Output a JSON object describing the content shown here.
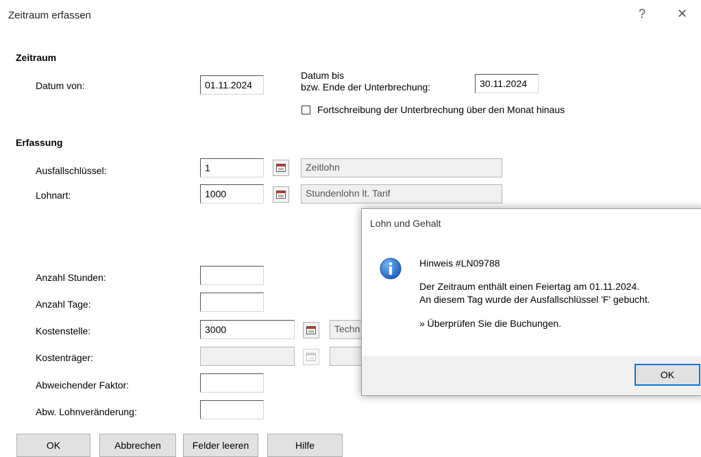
{
  "window": {
    "title": "Zeitraum erfassen",
    "help_glyph": "?",
    "close_glyph": "✕"
  },
  "zeitraum": {
    "heading": "Zeitraum",
    "datum_von_label": "Datum von:",
    "datum_von_value": "01.11.2024",
    "datum_bis_label_line1": "Datum bis",
    "datum_bis_label_line2": "bzw. Ende der Unterbrechung:",
    "datum_bis_value": "30.11.2024",
    "fortschreibung_label": "Fortschreibung der Unterbrechung über den Monat hinaus",
    "fortschreibung_checked": false
  },
  "erfassung": {
    "heading": "Erfassung",
    "ausfall_label": "Ausfallschlüssel:",
    "ausfall_value": "1",
    "ausfall_desc": "Zeitlohn",
    "lohnart_label": "Lohnart:",
    "lohnart_value": "1000",
    "lohnart_desc": "Stundenlohn lt. Tarif",
    "stunden_label": "Anzahl Stunden:",
    "stunden_value": "",
    "tage_label": "Anzahl Tage:",
    "tage_value": "",
    "kostenstelle_label": "Kostenstelle:",
    "kostenstelle_value": "3000",
    "kostenstelle_desc": "Techn",
    "kostentraeger_label": "Kostenträger:",
    "kostentraeger_value": "",
    "faktor_label": "Abweichender Faktor:",
    "faktor_value": "",
    "lohnveraenderung_label": "Abw. Lohnveränderung:",
    "lohnveraenderung_value": ""
  },
  "buttons": {
    "ok": "OK",
    "abbrechen": "Abbrechen",
    "felder_leeren": "Felder leeren",
    "hilfe": "Hilfe"
  },
  "message_box": {
    "title": "Lohn und Gehalt",
    "icon": "info-icon",
    "heading": "Hinweis #LN09788",
    "line1": "Der Zeitraum enthält einen Feiertag am 01.11.2024.",
    "line2": "An diesem Tag wurde der Ausfallschlüssel 'F' gebucht.",
    "line3": "» Überprüfen Sie die Buchungen.",
    "ok": "OK"
  }
}
